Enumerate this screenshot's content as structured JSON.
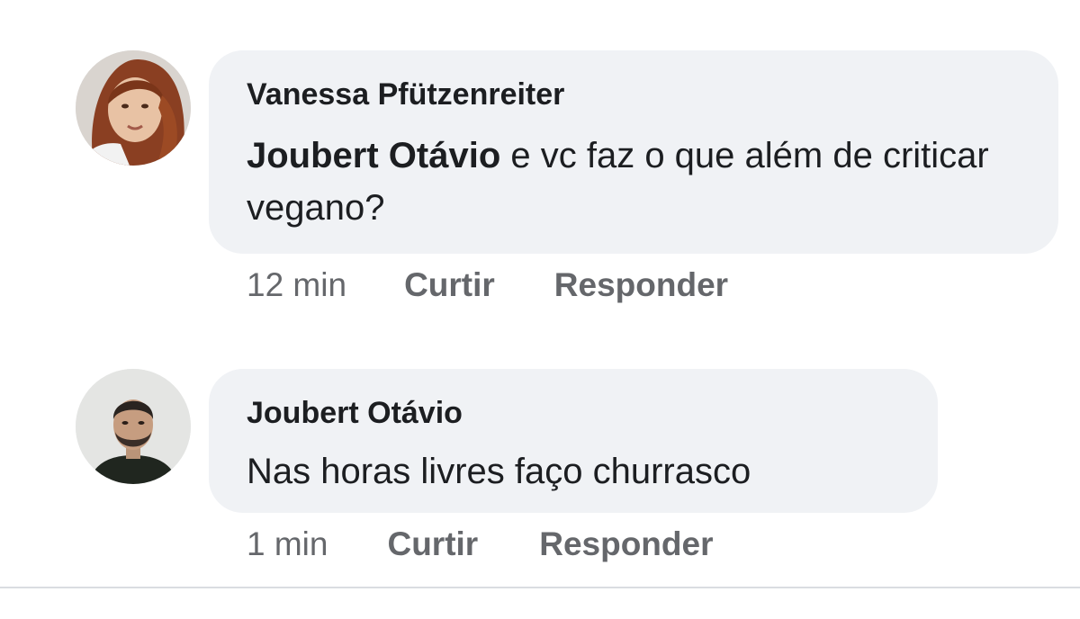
{
  "comments": [
    {
      "author": "Vanessa Pfützenreiter",
      "mention": "Joubert Otávio",
      "text_after_mention": " e vc faz o que além de criticar vegano?",
      "time": "12 min",
      "like_label": "Curtir",
      "reply_label": "Responder",
      "avatar_icon": "profile-photo-woman"
    },
    {
      "author": "Joubert Otávio",
      "text": "Nas horas livres faço churrasco",
      "time": "1 min",
      "like_label": "Curtir",
      "reply_label": "Responder",
      "avatar_icon": "profile-photo-man"
    }
  ],
  "colors": {
    "bubble": "#f0f2f5",
    "text": "#1c1e21",
    "meta": "#65676b"
  }
}
